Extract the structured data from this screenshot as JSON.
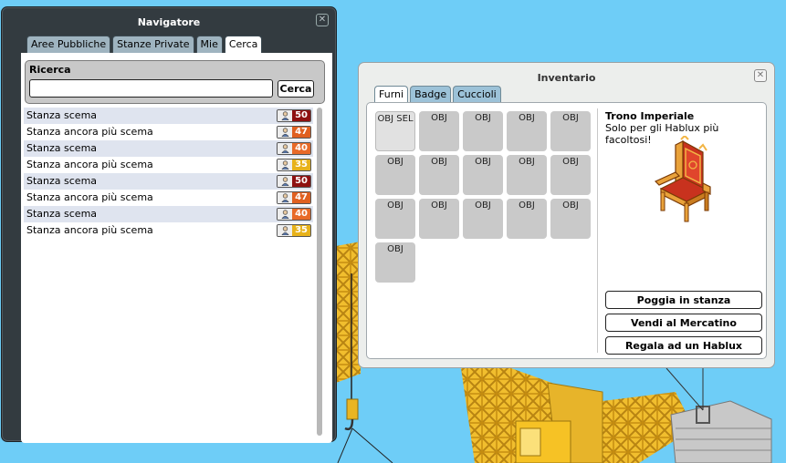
{
  "navigator": {
    "title": "Navigatore",
    "tabs": [
      "Aree Pubbliche",
      "Stanze Private",
      "Mie",
      "Cerca"
    ],
    "active_tab": "Cerca",
    "search": {
      "label": "Ricerca",
      "value": "",
      "button": "Cerca"
    },
    "rooms": [
      {
        "name": "Stanza scema",
        "count": "50",
        "color": "#8e1010"
      },
      {
        "name": "Stanza ancora più scema",
        "count": "47",
        "color": "#e06020"
      },
      {
        "name": "Stanza scema",
        "count": "40",
        "color": "#e86a28"
      },
      {
        "name": "Stanza ancora più scema",
        "count": "35",
        "color": "#e7b21a"
      },
      {
        "name": "Stanza scema",
        "count": "50",
        "color": "#8e1010"
      },
      {
        "name": "Stanza ancora più scema",
        "count": "47",
        "color": "#e06020"
      },
      {
        "name": "Stanza scema",
        "count": "40",
        "color": "#e86a28"
      },
      {
        "name": "Stanza ancora più scema",
        "count": "35",
        "color": "#e7b21a"
      }
    ]
  },
  "inventory": {
    "title": "Inventario",
    "tabs": [
      "Furni",
      "Badge",
      "Cuccioli"
    ],
    "active_tab": "Furni",
    "slots": [
      "OBJ SEL",
      "OBJ",
      "OBJ",
      "OBJ",
      "OBJ",
      "OBJ",
      "OBJ",
      "OBJ",
      "OBJ",
      "OBJ",
      "OBJ",
      "OBJ",
      "OBJ",
      "OBJ",
      "OBJ",
      "OBJ"
    ],
    "selected_item": {
      "name": "Trono Imperiale",
      "description": "Solo per gli Hablux più facoltosi!",
      "icon": "throne-icon"
    },
    "buttons": {
      "place": "Poggia in stanza",
      "sell": "Vendi al Mercatino",
      "gift": "Regala ad un Hablux"
    }
  },
  "icons": {
    "close": "close-icon",
    "user": "user-icon"
  },
  "colors": {
    "sky": "#6ecdf7",
    "crane": "#f2c230",
    "window_dark": "#333b40",
    "window_light": "#eceeec"
  }
}
